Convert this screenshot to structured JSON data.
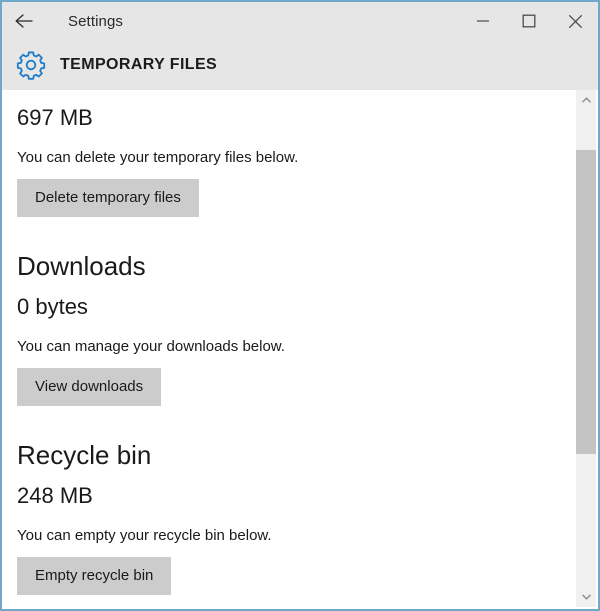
{
  "window": {
    "app_title": "Settings",
    "page_title": "TEMPORARY FILES",
    "back_label": "Back",
    "minimize_label": "Minimize",
    "maximize_label": "Maximize",
    "close_label": "Close",
    "accent_color": "#0078d7",
    "border_color": "#6fa8c8",
    "header_bg": "#e6e6e6",
    "button_bg": "#cccccc"
  },
  "sections": [
    {
      "heading": "",
      "value": "697 MB",
      "description": "You can delete your temporary files below.",
      "button": "Delete temporary files"
    },
    {
      "heading": "Downloads",
      "value": "0 bytes",
      "description": "You can manage your downloads below.",
      "button": "View downloads"
    },
    {
      "heading": "Recycle bin",
      "value": "248 MB",
      "description": "You can empty your recycle bin below.",
      "button": "Empty recycle bin"
    }
  ],
  "scrollbar": {
    "up_arrow": "scroll-up",
    "down_arrow": "scroll-down",
    "thumb": "scroll-thumb"
  }
}
